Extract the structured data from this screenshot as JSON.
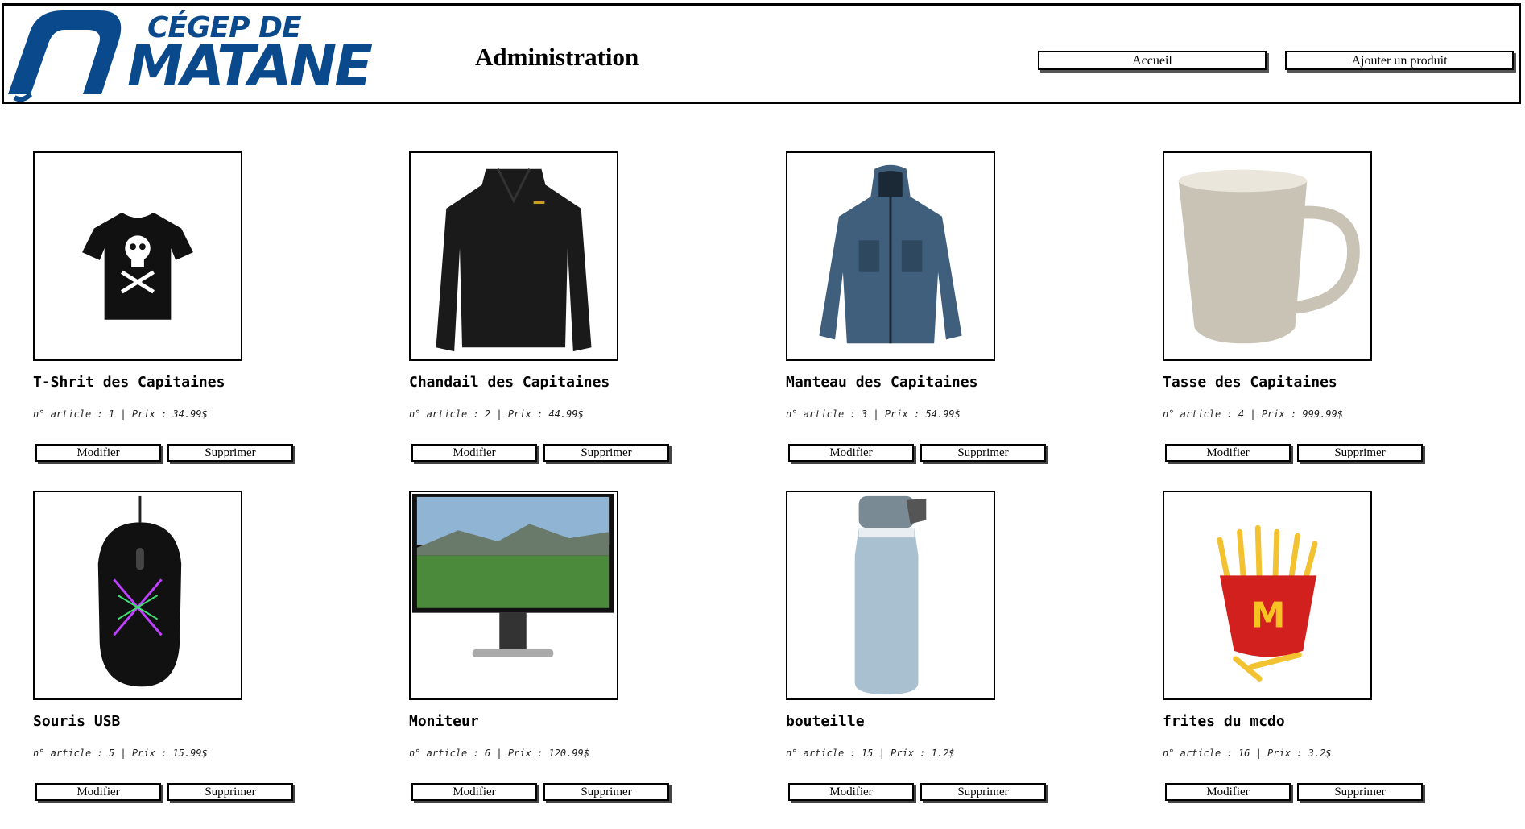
{
  "header": {
    "logo_line1": "CÉGEP DE",
    "logo_line2": "MATANE",
    "title": "Administration",
    "nav": {
      "home_label": "Accueil",
      "add_product_label": "Ajouter un produit"
    }
  },
  "colors": {
    "brand_blue": "#0a4a8c"
  },
  "product_actions": {
    "edit_label": "Modifier",
    "delete_label": "Supprimer"
  },
  "products": [
    {
      "name": "T-Shrit des Capitaines",
      "meta": "n° article : 1 | Prix : 34.99$",
      "image": "tshirt-image"
    },
    {
      "name": "Chandail des Capitaines",
      "meta": "n° article : 2 | Prix : 44.99$",
      "image": "sweater-image"
    },
    {
      "name": "Manteau des Capitaines",
      "meta": "n° article : 3 | Prix : 54.99$",
      "image": "jacket-image"
    },
    {
      "name": "Tasse des Capitaines",
      "meta": "n° article : 4 | Prix : 999.99$",
      "image": "mug-image"
    },
    {
      "name": "Souris USB",
      "meta": "n° article : 5 | Prix : 15.99$",
      "image": "mouse-image"
    },
    {
      "name": "Moniteur",
      "meta": "n° article : 6 | Prix : 120.99$",
      "image": "monitor-image"
    },
    {
      "name": "bouteille",
      "meta": "n° article : 15 | Prix : 1.2$",
      "image": "bottle-image"
    },
    {
      "name": "frites du mcdo",
      "meta": "n° article : 16 | Prix : 3.2$",
      "image": "fries-image"
    }
  ]
}
